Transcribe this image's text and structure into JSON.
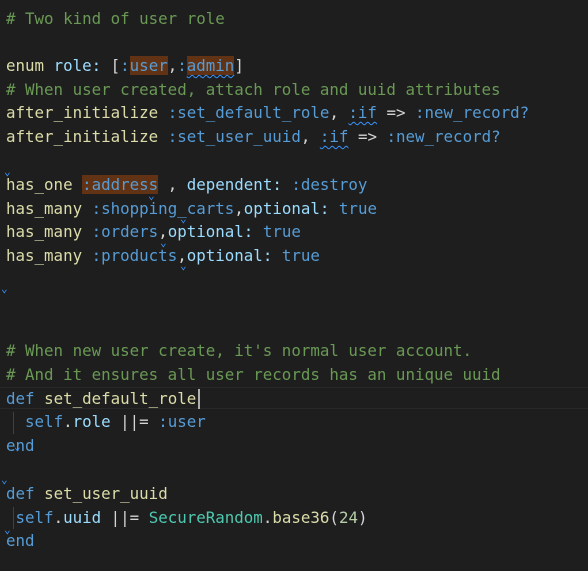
{
  "editor": {
    "lines": [
      {
        "tokens": [
          {
            "t": "# Two kind of user role",
            "c": "comment"
          }
        ]
      },
      {
        "tokens": []
      },
      {
        "tokens": [
          {
            "t": "enum",
            "c": "fn"
          },
          {
            "t": " ",
            "c": "plain"
          },
          {
            "t": "role:",
            "c": "ident"
          },
          {
            "t": " [",
            "c": "plain"
          },
          {
            "t": ":",
            "c": "sym"
          },
          {
            "t": "user",
            "c": "sym hl-brown-part"
          },
          {
            "t": ",",
            "c": "plain"
          },
          {
            "t": ":",
            "c": "sym"
          },
          {
            "t": "admin",
            "c": "sym"
          },
          {
            "t": "]",
            "c": "plain"
          }
        ]
      },
      {
        "tokens": [
          {
            "t": "# When user created, attach role and uuid attributes",
            "c": "comment"
          }
        ]
      },
      {
        "tokens": [
          {
            "t": "after_initialize",
            "c": "fn"
          },
          {
            "t": " ",
            "c": "plain"
          },
          {
            "t": ":set_default_role",
            "c": "sym"
          },
          {
            "t": ", ",
            "c": "plain"
          },
          {
            "t": ":if",
            "c": "sym"
          },
          {
            "t": " ",
            "c": "plain"
          },
          {
            "t": "=>",
            "c": "op"
          },
          {
            "t": " ",
            "c": "plain"
          },
          {
            "t": ":new_record?",
            "c": "sym"
          }
        ]
      },
      {
        "tokens": [
          {
            "t": "after_initialize",
            "c": "fn"
          },
          {
            "t": " ",
            "c": "plain"
          },
          {
            "t": ":set_user_uuid",
            "c": "sym"
          },
          {
            "t": ", ",
            "c": "plain"
          },
          {
            "t": ":if",
            "c": "sym"
          },
          {
            "t": " ",
            "c": "plain"
          },
          {
            "t": "=>",
            "c": "op"
          },
          {
            "t": " ",
            "c": "plain"
          },
          {
            "t": ":new_record?",
            "c": "sym"
          }
        ]
      },
      {
        "tokens": []
      },
      {
        "tokens": [
          {
            "t": "has_one",
            "c": "fn"
          },
          {
            "t": " ",
            "c": "plain"
          },
          {
            "t": ":address",
            "c": "sym"
          },
          {
            "t": " , ",
            "c": "plain"
          },
          {
            "t": "dependent:",
            "c": "ident"
          },
          {
            "t": " ",
            "c": "plain"
          },
          {
            "t": ":destroy",
            "c": "sym"
          }
        ]
      },
      {
        "tokens": [
          {
            "t": "has_many",
            "c": "fn"
          },
          {
            "t": " ",
            "c": "plain"
          },
          {
            "t": ":shopping_carts",
            "c": "sym"
          },
          {
            "t": ",",
            "c": "plain"
          },
          {
            "t": "optional:",
            "c": "ident"
          },
          {
            "t": " ",
            "c": "plain"
          },
          {
            "t": "true",
            "c": "kw"
          }
        ]
      },
      {
        "tokens": [
          {
            "t": "has_many",
            "c": "fn"
          },
          {
            "t": " ",
            "c": "plain"
          },
          {
            "t": ":orders",
            "c": "sym"
          },
          {
            "t": ",",
            "c": "plain"
          },
          {
            "t": "optional:",
            "c": "ident"
          },
          {
            "t": " ",
            "c": "plain"
          },
          {
            "t": "true",
            "c": "kw"
          }
        ]
      },
      {
        "tokens": [
          {
            "t": "has_many",
            "c": "fn"
          },
          {
            "t": " ",
            "c": "plain"
          },
          {
            "t": ":products",
            "c": "sym"
          },
          {
            "t": ",",
            "c": "plain"
          },
          {
            "t": "optional:",
            "c": "ident"
          },
          {
            "t": " ",
            "c": "plain"
          },
          {
            "t": "true",
            "c": "kw"
          }
        ]
      },
      {
        "tokens": []
      },
      {
        "tokens": []
      },
      {
        "tokens": []
      },
      {
        "tokens": [
          {
            "t": "# When new user create, it's normal user account.",
            "c": "comment"
          }
        ]
      },
      {
        "tokens": [
          {
            "t": "# And it ensures all user records has an unique uuid",
            "c": "comment"
          }
        ]
      },
      {
        "tokens": [
          {
            "t": "def",
            "c": "kw"
          },
          {
            "t": " ",
            "c": "plain"
          },
          {
            "t": "set_default_role",
            "c": "fn"
          }
        ]
      },
      {
        "tokens": [
          {
            "t": "  ",
            "c": "plain"
          },
          {
            "t": "self",
            "c": "kw"
          },
          {
            "t": ".",
            "c": "plain"
          },
          {
            "t": "role",
            "c": "ident"
          },
          {
            "t": " ||= ",
            "c": "plain"
          },
          {
            "t": ":user",
            "c": "sym"
          }
        ]
      },
      {
        "tokens": [
          {
            "t": "end",
            "c": "kw"
          }
        ]
      },
      {
        "tokens": []
      },
      {
        "tokens": [
          {
            "t": "def",
            "c": "kw"
          },
          {
            "t": " ",
            "c": "plain"
          },
          {
            "t": "set_user_uuid",
            "c": "fn"
          }
        ]
      },
      {
        "tokens": [
          {
            "t": " ",
            "c": "plain"
          },
          {
            "t": "self",
            "c": "kw"
          },
          {
            "t": ".",
            "c": "plain"
          },
          {
            "t": "uuid",
            "c": "ident"
          },
          {
            "t": " ||= ",
            "c": "plain"
          },
          {
            "t": "SecureRandom",
            "c": "const"
          },
          {
            "t": ".",
            "c": "plain"
          },
          {
            "t": "base36",
            "c": "fn"
          },
          {
            "t": "(",
            "c": "plain"
          },
          {
            "t": "24",
            "c": "num"
          },
          {
            "t": ")",
            "c": "plain"
          }
        ]
      },
      {
        "tokens": [
          {
            "t": "end",
            "c": "kw"
          }
        ]
      }
    ]
  }
}
